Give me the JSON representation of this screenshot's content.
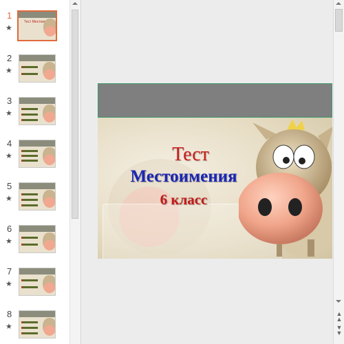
{
  "thumbnails": [
    {
      "number": "1",
      "star": "★",
      "title": "Тест Местоимения"
    },
    {
      "number": "2",
      "star": "★"
    },
    {
      "number": "3",
      "star": "★"
    },
    {
      "number": "4",
      "star": "★"
    },
    {
      "number": "5",
      "star": "★"
    },
    {
      "number": "6",
      "star": "★"
    },
    {
      "number": "7",
      "star": "★"
    },
    {
      "number": "8",
      "star": "★"
    }
  ],
  "selected_slide": "1",
  "slide": {
    "line1": "Тест",
    "line2": "Местоимения",
    "line3": "6 класс"
  },
  "colors": {
    "selection": "#e06a3b",
    "title_red": "#cc1b1b",
    "title_blue": "#1a26b8",
    "placeholder_border": "#3d9c6e"
  },
  "icons": {
    "star": "star-icon",
    "prev_slide": "double-chevron-up-icon",
    "next_slide": "double-chevron-down-icon"
  }
}
